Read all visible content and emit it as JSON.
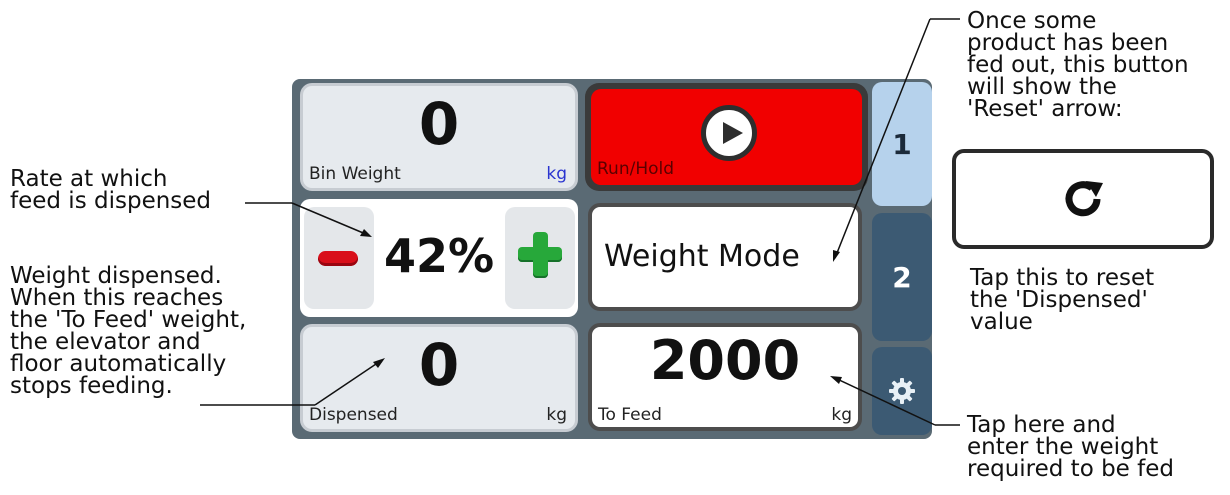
{
  "annotations": {
    "rate": "Rate at which\nfeed is dispensed",
    "weight": "Weight dispensed.\nWhen this reaches\nthe 'To Feed' weight,\nthe elevator and\nfloor automatically\nstops feeding.",
    "reset_top": "Once some\nproduct has been\nfed out, this button\nwill show the\n'Reset' arrow:",
    "reset_bottom": "Tap this to reset\nthe 'Dispensed'\nvalue",
    "to_feed": "Tap here and\nenter the weight\nrequired to be fed"
  },
  "panel": {
    "bin_weight": {
      "value": "0",
      "label": "Bin Weight",
      "unit": "kg"
    },
    "run_hold": {
      "label": "Run/Hold",
      "icon": "play-icon"
    },
    "rate": {
      "value": "42%",
      "minus_icon": "minus-icon",
      "plus_icon": "plus-icon"
    },
    "mode": {
      "label": "Weight Mode"
    },
    "dispensed": {
      "value": "0",
      "label": "Dispensed",
      "unit": "kg"
    },
    "to_feed": {
      "value": "2000",
      "label": "To Feed",
      "unit": "kg"
    },
    "tabs": [
      {
        "label": "1",
        "active": true
      },
      {
        "label": "2",
        "active": false
      },
      {
        "icon": "gear-icon"
      }
    ]
  },
  "reset_button": {
    "icon": "reset-arrow-icon"
  },
  "colors": {
    "run_red": "#f10000",
    "tab_active": "#b6d2ec",
    "tab_inactive": "#3c5a73",
    "minus_red": "#d90f1a",
    "plus_green": "#27a83a",
    "kg_blue": "#2a34d0"
  }
}
